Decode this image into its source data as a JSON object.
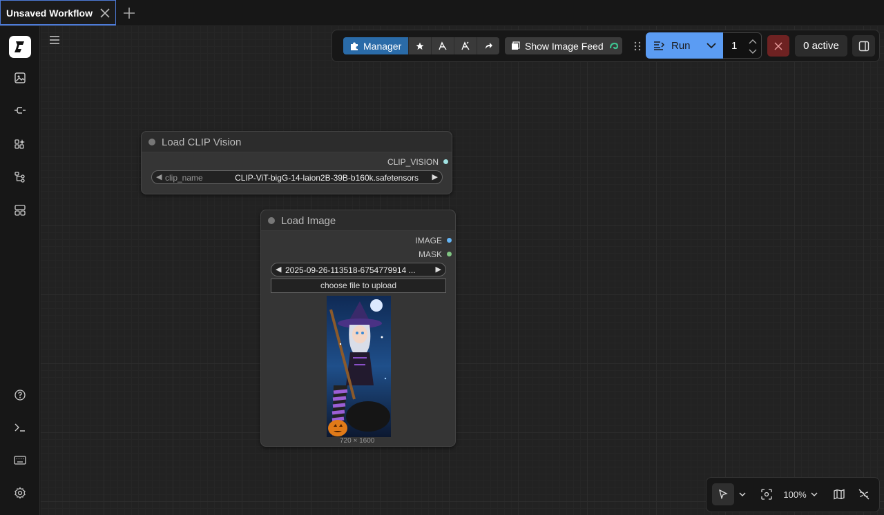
{
  "tab": {
    "title": "Unsaved Workflow"
  },
  "toolbar": {
    "manager_label": "Manager",
    "feed_label": "Show Image Feed",
    "run_label": "Run",
    "queue_count": "1",
    "active_label": "0 active"
  },
  "nodes": {
    "clip_vision": {
      "title": "Load CLIP Vision",
      "output": "CLIP_VISION",
      "widget_label": "clip_name",
      "widget_value": "CLIP-ViT-bigG-14-laion2B-39B-b160k.safetensors"
    },
    "load_image": {
      "title": "Load Image",
      "outputs": [
        "IMAGE",
        "MASK"
      ],
      "image_value": "2025-09-26-113518-6754779914 ...",
      "upload_label": "choose file to upload",
      "dimensions": "720 × 1600"
    }
  },
  "canvas_controls": {
    "zoom": "100%"
  },
  "colors": {
    "accent_blue": "#5b9cf3",
    "manager_blue": "#2a6ba8",
    "cancel_red": "#6e2222",
    "image_socket": "#64b5f6",
    "mask_socket": "#81c784",
    "clip_socket": "#a1e3e3"
  },
  "icons": {
    "sidebar": [
      "logo-icon",
      "images-icon",
      "model-icon",
      "nodes-icon",
      "workflow-icon",
      "templates-icon",
      "help-icon",
      "terminal-icon",
      "keyboard-icon",
      "settings-icon"
    ]
  }
}
